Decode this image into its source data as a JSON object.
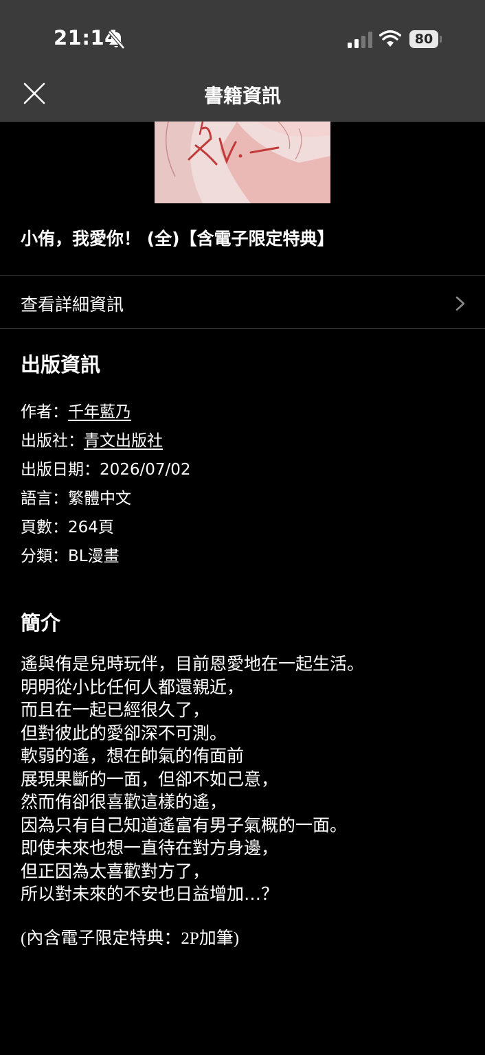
{
  "status_bar": {
    "time": "21:14",
    "battery": "80"
  },
  "nav": {
    "title": "書籍資訊"
  },
  "book": {
    "title": "小侑，我愛你！ (全)【含電子限定特典】",
    "detail_link": "查看詳細資訊"
  },
  "publication": {
    "heading": "出版資訊",
    "author_label": "作者：",
    "author": "千年藍乃",
    "publisher_label": "出版社：",
    "publisher": "青文出版社",
    "date_label": "出版日期：",
    "date": "2026/07/02",
    "language_label": "語言：",
    "language": "繁體中文",
    "pages_label": "頁數：",
    "pages": "264頁",
    "category_label": "分類：",
    "category": "BL漫畫"
  },
  "summary": {
    "heading": "簡介",
    "lines": [
      "遙與侑是兒時玩伴，目前恩愛地在一起生活。",
      "明明從小比任何人都還親近，",
      "而且在一起已經很久了，",
      "但對彼此的愛卻深不可測。",
      "軟弱的遙，想在帥氣的侑面前",
      "展現果斷的一面，但卻不如己意，",
      "然而侑卻很喜歡這樣的遙，",
      "因為只有自己知道遙富有男子氣概的一面。",
      "即使未來也想一直待在對方身邊，",
      "但正因為太喜歡對方了，",
      "所以對未來的不安也日益增加…？"
    ],
    "bonus": "(內含電子限定特典：2P加筆)"
  }
}
